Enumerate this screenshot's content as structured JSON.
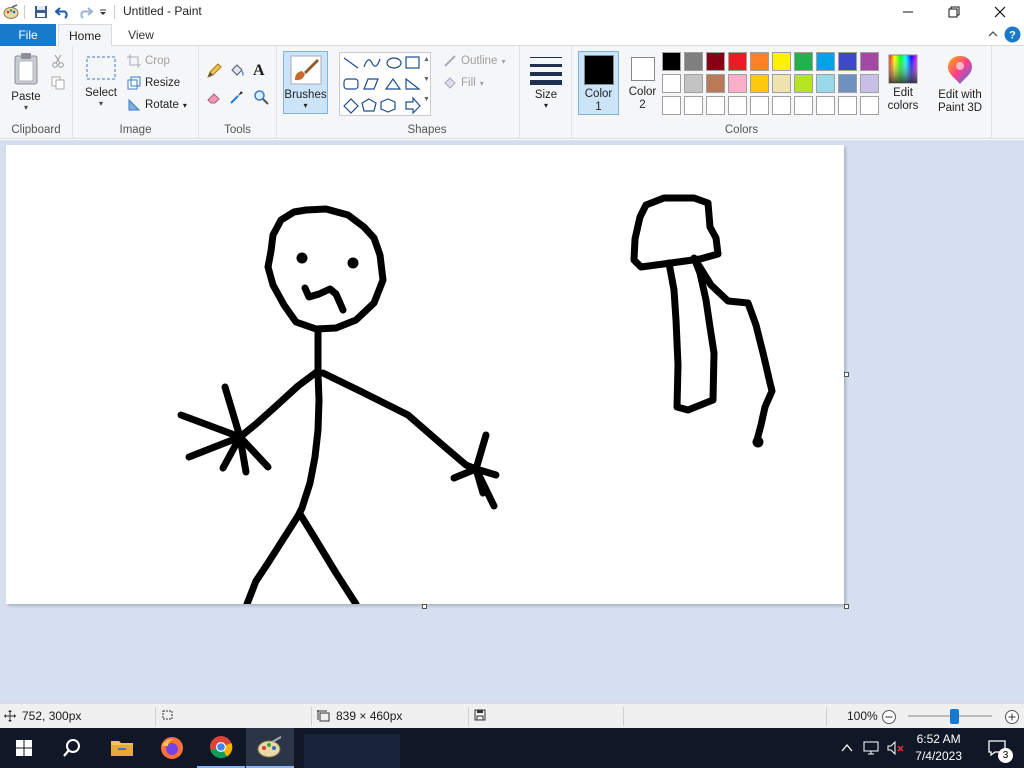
{
  "window": {
    "title": "Untitled - Paint"
  },
  "tabs": [
    {
      "label": "File"
    },
    {
      "label": "Home"
    },
    {
      "label": "View"
    }
  ],
  "ribbon": {
    "clipboard": {
      "paste": "Paste",
      "group": "Clipboard"
    },
    "image": {
      "select": "Select",
      "crop": "Crop",
      "resize": "Resize",
      "rotate": "Rotate",
      "group": "Image"
    },
    "tools": {
      "group": "Tools"
    },
    "brushes": {
      "label": "Brushes"
    },
    "shapes": {
      "outline": "Outline",
      "fill": "Fill",
      "group": "Shapes"
    },
    "size": {
      "label": "Size"
    },
    "colors": {
      "color1": "Color 1",
      "color2": "Color 2",
      "color1_value": "#000000",
      "color2_value": "#ffffff",
      "edit_colors": "Edit colors",
      "group": "Colors",
      "palette_row1": [
        "#000000",
        "#7f7f7f",
        "#880015",
        "#ed1c24",
        "#ff7f27",
        "#fff200",
        "#22b14c",
        "#00a2e8",
        "#3f48cc",
        "#a349a4"
      ],
      "palette_row2": [
        "#ffffff",
        "#c3c3c3",
        "#b97a57",
        "#ffaec9",
        "#ffc90e",
        "#efe4b0",
        "#b5e61d",
        "#99d9ea",
        "#7092be",
        "#c8bfe7"
      ],
      "palette_row3": [
        "#ffffff",
        "#ffffff",
        "#ffffff",
        "#ffffff",
        "#ffffff",
        "#ffffff",
        "#ffffff",
        "#ffffff",
        "#ffffff",
        "#ffffff"
      ]
    },
    "paint3d": {
      "label": "Edit with Paint 3D"
    }
  },
  "status": {
    "cursor_pos": "752, 300px",
    "canvas_size": "839 × 460px",
    "zoom": "100%",
    "zoom_fraction": 0.55
  },
  "taskbar": {
    "time": "6:52 AM",
    "date": "7/4/2023",
    "notifications": "3"
  }
}
